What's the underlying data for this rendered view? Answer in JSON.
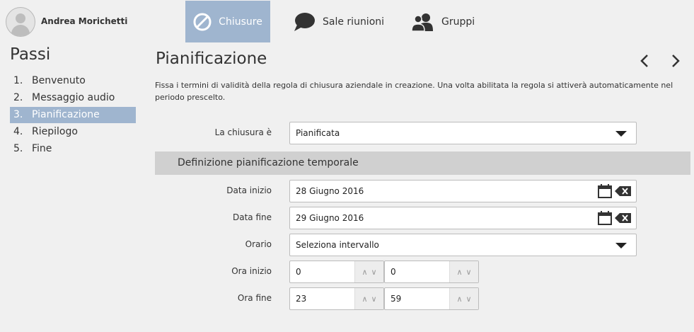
{
  "user": {
    "name": "Andrea Morichetti"
  },
  "tabs": [
    {
      "label": "Chiusure",
      "icon": "no-entry-icon",
      "active": true
    },
    {
      "label": "Sale riunioni",
      "icon": "speech-bubble-icon",
      "active": false
    },
    {
      "label": "Gruppi",
      "icon": "users-icon",
      "active": false
    }
  ],
  "steps": {
    "title": "Passi",
    "items": [
      {
        "num": "1.",
        "label": "Benvenuto"
      },
      {
        "num": "2.",
        "label": "Messaggio audio"
      },
      {
        "num": "3.",
        "label": "Pianificazione",
        "active": true
      },
      {
        "num": "4.",
        "label": "Riepilogo"
      },
      {
        "num": "5.",
        "label": "Fine"
      }
    ]
  },
  "main": {
    "title": "Pianificazione",
    "description": "Fissa i termini di validità della regola di chiusura aziendale in creazione. Una volta abilitata la regola si attiverà automaticamente nel periodo prescelto.",
    "closure": {
      "label": "La chiusura è",
      "value": "Pianificata"
    },
    "section_title": "Definizione pianificazione temporale",
    "start_date": {
      "label": "Data inizio",
      "value": "28 Giugno 2016"
    },
    "end_date": {
      "label": "Data fine",
      "value": "29 Giugno 2016"
    },
    "schedule": {
      "label": "Orario",
      "value": "Seleziona intervallo"
    },
    "start_time": {
      "label": "Ora inizio",
      "hours": "0",
      "minutes": "0"
    },
    "end_time": {
      "label": "Ora fine",
      "hours": "23",
      "minutes": "59"
    }
  },
  "colors": {
    "accent": "#9fb5cf",
    "background": "#f0f0f0",
    "section": "#d0d0d0"
  }
}
